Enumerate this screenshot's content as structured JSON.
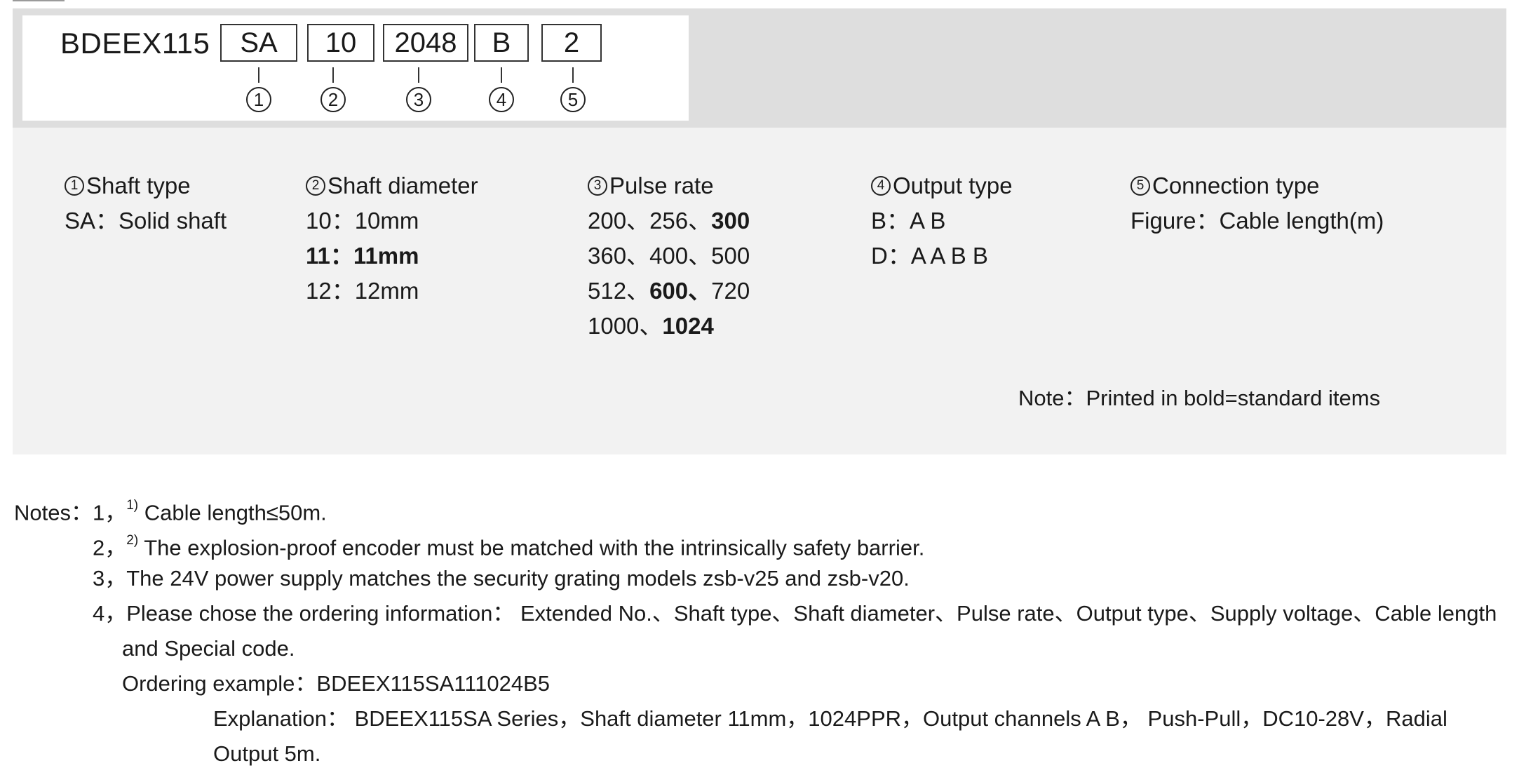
{
  "code": {
    "model": "BDEEX115",
    "segments": [
      "SA",
      "10",
      "2048",
      "B",
      "2"
    ],
    "markers": [
      "1",
      "2",
      "3",
      "4",
      "5"
    ]
  },
  "columns": {
    "shaft_type": {
      "title": "Shaft type",
      "lines": [
        "SA：Solid shaft"
      ]
    },
    "shaft_diameter": {
      "title": "Shaft diameter",
      "lines": [
        "10：10mm",
        "11：11mm",
        "12：12mm"
      ]
    },
    "pulse_rate": {
      "title": "Pulse rate",
      "rows": [
        [
          "200、",
          "256、",
          "300"
        ],
        [
          "360、",
          "400、",
          "500"
        ],
        [
          "512、",
          "600、",
          "720"
        ],
        [
          "1000、",
          "1024"
        ]
      ]
    },
    "output_type": {
      "title": "Output type",
      "lines": [
        "B：A B",
        "D：A A B B"
      ]
    },
    "connection_type": {
      "title": "Connection type",
      "lines": [
        "Figure：Cable length(m)"
      ]
    }
  },
  "note": "Note：Printed in bold=standard items",
  "notes": {
    "label": "Notes：",
    "n1": {
      "num": "1，",
      "sup": "1)",
      "text": " Cable length≤50m."
    },
    "n2": {
      "num": "2，",
      "sup": "2)",
      "text": " The explosion-proof encoder must be matched with the intrinsically safety barrier."
    },
    "n3": "3，The 24V power supply matches the security grating models zsb-v25 and zsb-v20.",
    "n4a": "4，Please chose the ordering information： Extended No.、Shaft type、Shaft diameter、Pulse rate、Output type、Supply voltage、Cable length",
    "n4b": "and Special code.",
    "example": "Ordering example：BDEEX115SA111024B5",
    "explanation_a": "Explanation： BDEEX115SA Series，Shaft diameter 11mm，1024PPR，Output channels A B， Push-Pull，DC10-28V，Radial",
    "explanation_b": "Output 5m."
  }
}
